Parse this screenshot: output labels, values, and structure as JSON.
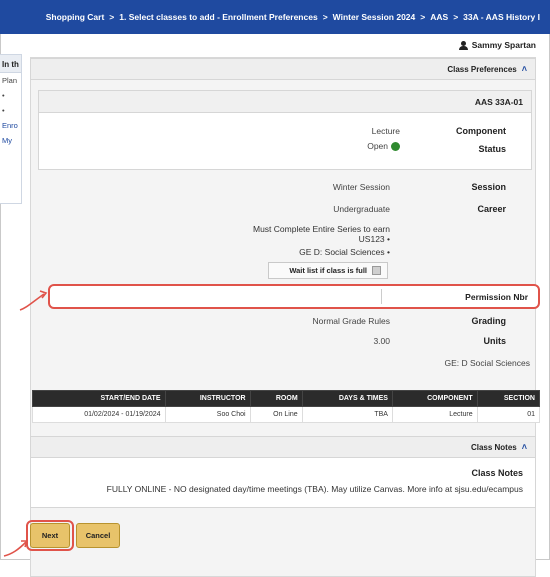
{
  "breadcrumb": {
    "items": [
      "Shopping Cart",
      "1. Select classes to add - Enrollment Preferences",
      "Winter Session 2024",
      "AAS",
      "33A - AAS History I"
    ],
    "separator": ">"
  },
  "user": {
    "name": "Sammy Spartan"
  },
  "side_panel": {
    "header": "In th",
    "lines": [
      "Plan",
      "•",
      "•",
      "Enro",
      "My"
    ]
  },
  "class_preferences": {
    "header": "Class Preferences",
    "card_title": "AAS  33A-01",
    "component_label": "Component",
    "component_value": "Lecture",
    "status_label": "Status",
    "status_value": "Open",
    "session_label": "Session",
    "session_value": "Winter Session",
    "career_label": "Career",
    "career_value": "Undergraduate",
    "notes": [
      "Must Complete Entire Series to earn US123",
      "GE D: Social Sciences"
    ],
    "waitlist_label": "Wait list if class is full",
    "permission_label": "Permission Nbr",
    "grading_label": "Grading",
    "grading_value": "Normal Grade Rules",
    "units_label": "Units",
    "units_value": "3.00",
    "ge_text": "GE: D Social Sciences"
  },
  "table": {
    "headers": [
      "SECTION",
      "COMPONENT",
      "DAYS & TIMES",
      "ROOM",
      "INSTRUCTOR",
      "START/END DATE"
    ],
    "rows": [
      [
        "01",
        "Lecture",
        "TBA",
        "On Line",
        "Soo Choi",
        "01/02/2024 - 01/19/2024"
      ]
    ]
  },
  "class_notes": {
    "header": "Class Notes",
    "title": "Class Notes",
    "body": "FULLY ONLINE - NO designated day/time meetings (TBA). May utilize Canvas. More info at sjsu.edu/ecampus"
  },
  "buttons": {
    "next": "Next",
    "cancel": "Cancel"
  },
  "colors": {
    "nav": "#1f4aa0",
    "button": "#e8c36a",
    "highlight": "#e0534a",
    "status_open": "#2f8a2f"
  }
}
